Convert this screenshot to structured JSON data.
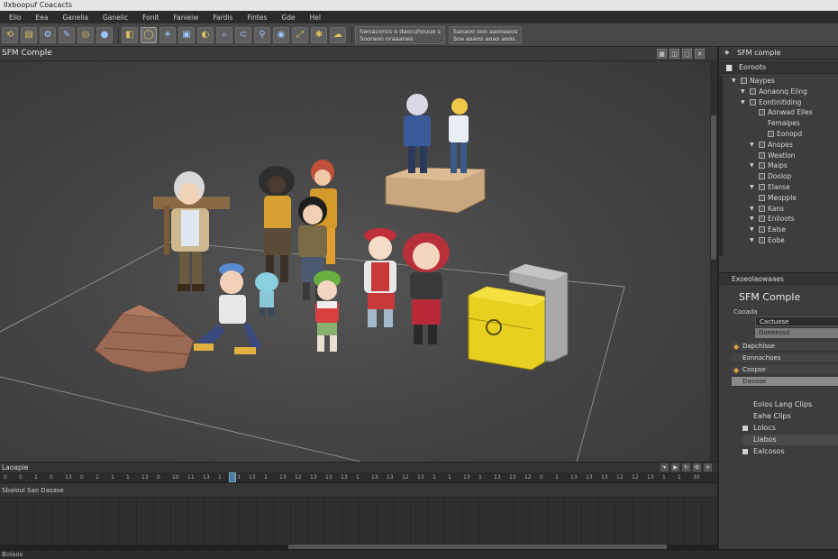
{
  "window": {
    "title": "Ilxboopuf Coacacts"
  },
  "menu": [
    "Eilo",
    "Eea",
    "Ganelia",
    "Ganelic",
    "Fonlt",
    "Fanieiw",
    "Fardis",
    "Fintes",
    "Gde",
    "Hel"
  ],
  "toolbar": {
    "text_block_1_line1": "Swnaconcs o daocuhouue s",
    "text_block_1_line2": "Sooraon nraaanes",
    "text_block_2_line1": "Saoaoo ooo aaooaeos",
    "text_block_2_line2": "Soa asaoo aoao aoos"
  },
  "viewport": {
    "title": "SFM Comple"
  },
  "timeline": {
    "title": "Laoapie",
    "track_label": "Sbaloul Sao Dasase",
    "ruler_ticks": [
      "0",
      "0",
      "1",
      "0",
      "13",
      "0",
      "1",
      "1",
      "1",
      "13",
      "0",
      "10",
      "11",
      "13",
      "1",
      "13",
      "13",
      "1",
      "13",
      "12",
      "13",
      "13",
      "13",
      "1",
      "13",
      "13",
      "12",
      "13",
      "1",
      "1",
      "13",
      "1",
      "13",
      "13",
      "12",
      "0",
      "1",
      "13",
      "13",
      "13",
      "12",
      "12",
      "13",
      "1",
      "1",
      "30"
    ]
  },
  "status": {
    "text": "Bolaos"
  },
  "panel": {
    "outliner_title": "SFM comple",
    "root_label": "Eoroots",
    "tree": [
      {
        "label": "Naypes",
        "indent": 0,
        "arrow": "▼",
        "box": true
      },
      {
        "label": "Aonaonq Eling",
        "indent": 1,
        "arrow": "▼",
        "box": true
      },
      {
        "label": "Eontinitlding",
        "indent": 1,
        "arrow": "▼",
        "box": true
      },
      {
        "label": "Aonwad Eiles",
        "indent": 2,
        "arrow": "",
        "box": true
      },
      {
        "label": "Femaipes",
        "indent": 2,
        "arrow": "",
        "box": false
      },
      {
        "label": "Eonopd",
        "indent": 3,
        "arrow": "",
        "box": true
      },
      {
        "label": "Anopes",
        "indent": 2,
        "arrow": "▼",
        "box": true
      },
      {
        "label": "Weatlon",
        "indent": 2,
        "arrow": "",
        "box": true
      },
      {
        "label": "Maips",
        "indent": 2,
        "arrow": "▼",
        "box": true
      },
      {
        "label": "Doolop",
        "indent": 2,
        "arrow": "",
        "box": true
      },
      {
        "label": "Elanse",
        "indent": 2,
        "arrow": "▼",
        "box": true
      },
      {
        "label": "Meopple",
        "indent": 2,
        "arrow": "",
        "box": true
      },
      {
        "label": "Kans",
        "indent": 2,
        "arrow": "▼",
        "box": true
      },
      {
        "label": "Eniloots",
        "indent": 2,
        "arrow": "▼",
        "box": true
      },
      {
        "label": "Ealse",
        "indent": 2,
        "arrow": "▼",
        "box": true
      },
      {
        "label": "Eobe",
        "indent": 2,
        "arrow": "▼",
        "box": true
      }
    ],
    "props_header": "Exoeolaowaaes",
    "props_title": "SFM Comple",
    "props_sub": "Cooada",
    "field_1": "Cactuose",
    "field_2": "Goeeessd",
    "items": [
      {
        "label": "Dapchlsse",
        "icon": "flame-icon",
        "selected": false
      },
      {
        "label": "Eonnachoes",
        "icon": "",
        "selected": false
      },
      {
        "label": "Coopse",
        "icon": "flame-icon",
        "selected": false
      },
      {
        "label": "Daoose",
        "icon": "",
        "selected": true
      }
    ],
    "clips": [
      {
        "label": "Eolos Lang Clips",
        "checked": false,
        "selected": false
      },
      {
        "label": "Eahe Clips",
        "checked": false,
        "selected": false
      },
      {
        "label": "Lolocs",
        "checked": true,
        "selected": false
      },
      {
        "label": "Liabos",
        "checked": false,
        "selected": true
      },
      {
        "label": "Ealcosos",
        "checked": true,
        "selected": false
      }
    ]
  },
  "colors": {
    "accent": "#4a7ca8",
    "flame": "#e6a040",
    "bg": "#3a3a3a"
  }
}
